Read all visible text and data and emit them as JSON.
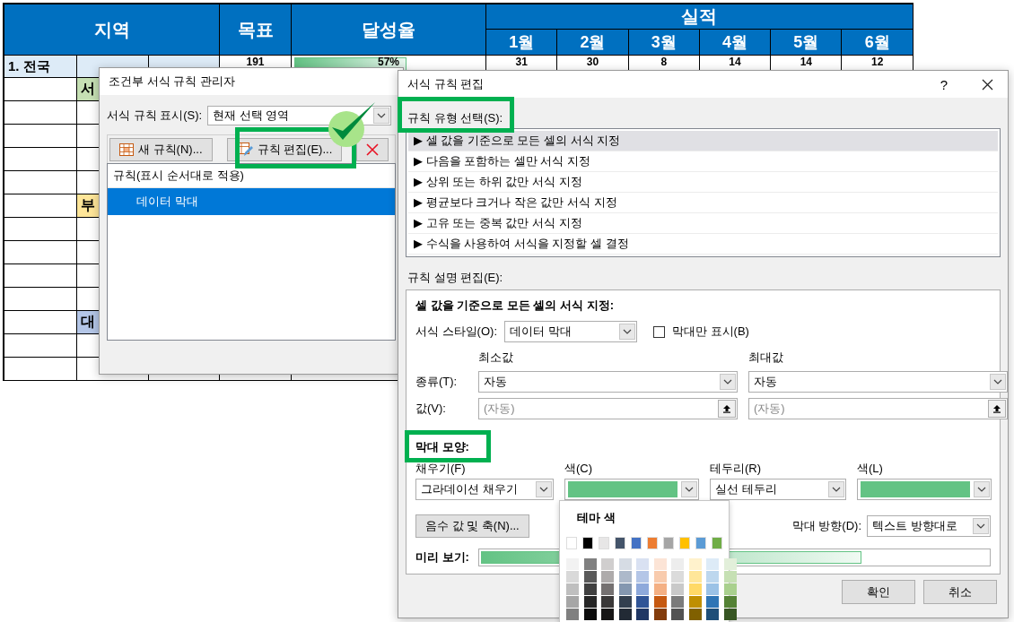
{
  "sheet": {
    "headers": {
      "region": "지역",
      "target": "목표",
      "rate": "달성율",
      "actual": "실적"
    },
    "months": [
      "1월",
      "2월",
      "3월",
      "4월",
      "5월",
      "6월"
    ],
    "total": {
      "region": "1. 전국",
      "target": "191",
      "rate": "57%",
      "level": 0.57,
      "months": [
        "31",
        "30",
        "8",
        "14",
        "14",
        "12"
      ]
    },
    "rows": [
      {
        "kind": "group",
        "label": "서",
        "color": "#c6e0b4"
      },
      {
        "kind": "blank"
      },
      {
        "kind": "blank"
      },
      {
        "kind": "blank"
      },
      {
        "kind": "blank"
      },
      {
        "kind": "group",
        "label": "부",
        "color": "#ffe699"
      },
      {
        "kind": "blank"
      },
      {
        "kind": "blank"
      },
      {
        "kind": "blank"
      },
      {
        "kind": "blank"
      },
      {
        "kind": "group",
        "label": "대",
        "color": "#b4c6e7"
      },
      {
        "kind": "blank"
      },
      {
        "kind": "blank"
      }
    ]
  },
  "manager": {
    "title": "조건부 서식 규칙 관리자",
    "show_label": "서식 규칙 표시(S):",
    "show_value": "현재 선택 영역",
    "buttons": [
      {
        "kind": "new",
        "label": "새 규칙(N)..."
      },
      {
        "kind": "edit",
        "label": "규칙 편집(E)..."
      },
      {
        "kind": "delete"
      }
    ],
    "list_header": "규칙(표시 순서대로 적용)",
    "rules": [
      {
        "label": "데이터 막대",
        "selected": true
      }
    ]
  },
  "editor": {
    "title": "서식 규칙 편집",
    "help": "?",
    "type_label": "규칙 유형 선택(S):",
    "types": [
      {
        "label": "▶ 셀 값을 기준으로 모든 셀의 서식 지정",
        "selected": true
      },
      {
        "label": "▶ 다음을 포함하는 셀만 서식 지정",
        "selected": false
      },
      {
        "label": "▶ 상위 또는 하위 값만 서식 지정",
        "selected": false
      },
      {
        "label": "▶ 평균보다 크거나 작은 값만 서식 지정",
        "selected": false
      },
      {
        "label": "▶ 고유 또는 중복 값만 서식 지정",
        "selected": false
      },
      {
        "label": "▶ 수식을 사용하여 서식을 지정할 셀 결정",
        "selected": false
      }
    ],
    "desc_label": "규칙 설명 편집(E):",
    "desc_title": "셀 값을 기준으로 모든 셀의 서식 지정:",
    "style_label": "서식 스타일(O):",
    "style_value": "데이터 막대",
    "bar_only": {
      "label": "막대만 표시(B)",
      "checked": false
    },
    "min_label": "최소값",
    "max_label": "최대값",
    "type_row_label": "종류(T):",
    "min_type": "자동",
    "max_type": "자동",
    "value_row_label": "값(V):",
    "min_value_placeholder": "(자동)",
    "max_value_placeholder": "(자동)",
    "appearance_title": "막대 모양:",
    "fill_label": "채우기(F)",
    "fill_value": "그라데이션 채우기",
    "fill_color": {
      "label": "색(C)",
      "color": "#63c384"
    },
    "border_label": "테두리(R)",
    "border_value": "실선 테두리",
    "border_color": {
      "label": "색(L)",
      "color": "#63c384"
    },
    "negative_button": "음수 값 및 축(N)...",
    "direction_label": "막대 방향(D):",
    "direction_value": "텍스트 방향대로",
    "preview_label": "미리 보기:",
    "buttons": [
      "확인",
      "취소"
    ]
  },
  "palette": {
    "title": "테마 색",
    "colors": [
      {
        "color": "#ffffff",
        "shades": [
          {
            "color": "#f2f2f2"
          },
          {
            "color": "#d9d9d9"
          },
          {
            "color": "#bfbfbf"
          },
          {
            "color": "#a6a6a6"
          },
          {
            "color": "#808080"
          }
        ]
      },
      {
        "color": "#000000",
        "shades": [
          {
            "color": "#808080"
          },
          {
            "color": "#595959"
          },
          {
            "color": "#404040"
          },
          {
            "color": "#262626"
          },
          {
            "color": "#0d0d0d"
          }
        ]
      },
      {
        "color": "#e7e6e6",
        "shades": [
          {
            "color": "#d0cece"
          },
          {
            "color": "#aeabab"
          },
          {
            "color": "#757171"
          },
          {
            "color": "#3a3838"
          },
          {
            "color": "#171616"
          }
        ]
      },
      {
        "color": "#44546a",
        "shades": [
          {
            "color": "#d6dce4"
          },
          {
            "color": "#adb9ca"
          },
          {
            "color": "#8497b0"
          },
          {
            "color": "#333f4f"
          },
          {
            "color": "#222a35"
          }
        ]
      },
      {
        "color": "#4472c4",
        "shades": [
          {
            "color": "#d9e1f2"
          },
          {
            "color": "#b4c6e7"
          },
          {
            "color": "#8ea9db"
          },
          {
            "color": "#305496"
          },
          {
            "color": "#203764"
          }
        ]
      },
      {
        "color": "#ed7d31",
        "shades": [
          {
            "color": "#fce4d6"
          },
          {
            "color": "#f8cbad"
          },
          {
            "color": "#f4b084"
          },
          {
            "color": "#c65911"
          },
          {
            "color": "#833c0c"
          }
        ]
      },
      {
        "color": "#a5a5a5",
        "shades": [
          {
            "color": "#ededed"
          },
          {
            "color": "#dbdbdb"
          },
          {
            "color": "#c9c9c9"
          },
          {
            "color": "#7b7b7b"
          },
          {
            "color": "#525252"
          }
        ]
      },
      {
        "color": "#ffc000",
        "shades": [
          {
            "color": "#fff2cc"
          },
          {
            "color": "#ffe699"
          },
          {
            "color": "#ffd966"
          },
          {
            "color": "#bf8f00"
          },
          {
            "color": "#806000"
          }
        ]
      },
      {
        "color": "#5b9bd5",
        "shades": [
          {
            "color": "#ddebf7"
          },
          {
            "color": "#bdd7ee"
          },
          {
            "color": "#9bc2e6"
          },
          {
            "color": "#2f75b5"
          },
          {
            "color": "#1f4e78"
          }
        ]
      },
      {
        "color": "#70ad47",
        "shades": [
          {
            "color": "#e2efda"
          },
          {
            "color": "#c6e0b4"
          },
          {
            "color": "#a9d08e"
          },
          {
            "color": "#548235"
          },
          {
            "color": "#375623"
          }
        ]
      }
    ]
  }
}
